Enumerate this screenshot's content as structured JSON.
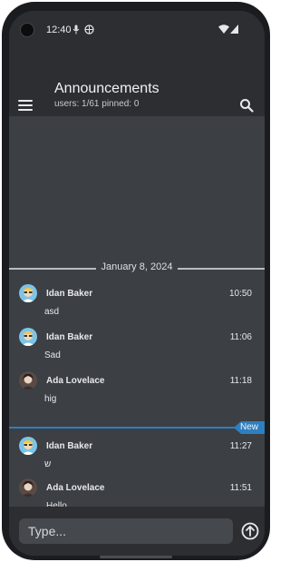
{
  "status_bar": {
    "time": "12:40"
  },
  "header": {
    "title": "Announcements",
    "subtitle": "users: 1/61 pinned: 0"
  },
  "chat": {
    "date_separator": "January 8, 2024",
    "new_label": "New",
    "messages": [
      {
        "author": "Idan Baker",
        "time": "10:50",
        "text": "asd"
      },
      {
        "author": "Idan Baker",
        "time": "11:06",
        "text": "Sad"
      },
      {
        "author": "Ada Lovelace",
        "time": "11:18",
        "text": "hig"
      },
      {
        "author": "Idan Baker",
        "time": "11:27",
        "text": "ש"
      },
      {
        "author": "Ada Lovelace",
        "time": "11:51",
        "text": "Hello"
      }
    ]
  },
  "composer": {
    "placeholder": "Type..."
  },
  "colors": {
    "background": "#3c3f44",
    "header": "#2c2e32",
    "accent": "#2e7fbf"
  },
  "icons": [
    "menu-icon",
    "search-icon",
    "send-icon",
    "wifi-icon",
    "signal-icon"
  ]
}
